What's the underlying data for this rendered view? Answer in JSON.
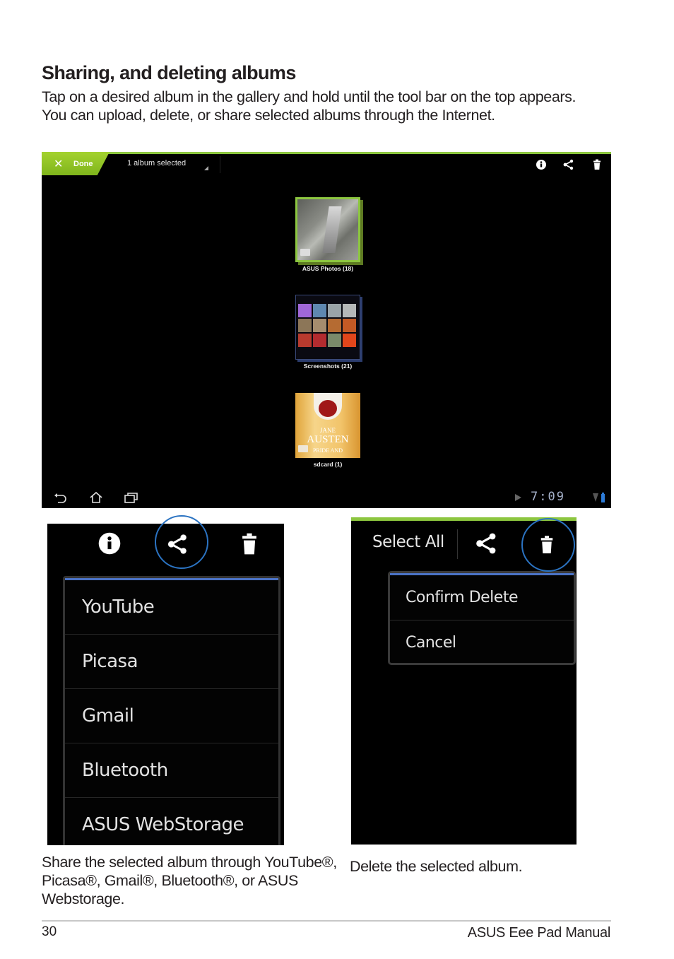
{
  "page": {
    "title": "Sharing, and deleting albums",
    "intro": "Tap on a desired album in the gallery and hold until the tool bar on the top appears. You can upload, delete, or share selected albums through the Internet.",
    "page_number": "30",
    "manual_name": "ASUS Eee Pad Manual"
  },
  "gallery_screen": {
    "done_label": "Done",
    "selection_label": "1 album selected",
    "toolbar_icons": [
      "info-icon",
      "share-icon",
      "trash-icon"
    ],
    "albums": [
      {
        "name": "ASUS Photos (18)",
        "selected": true
      },
      {
        "name": "Screenshots (21)",
        "selected": false
      },
      {
        "name": "sdcard (1)",
        "selected": false
      }
    ],
    "cover_text": {
      "line1": "JANE",
      "line2": "AUSTEN",
      "line3": "PRIDE AND"
    },
    "clock": "7:09",
    "nav_icons": [
      "back-icon",
      "home-icon",
      "recent-apps-icon"
    ]
  },
  "share_screen": {
    "toolbar_icons": [
      "info-icon",
      "share-icon",
      "trash-icon"
    ],
    "menu_items": [
      "YouTube",
      "Picasa",
      "Gmail",
      "Bluetooth",
      "ASUS WebStorage"
    ]
  },
  "delete_screen": {
    "select_all_label": "Select All",
    "menu_items": [
      "Confirm Delete",
      "Cancel"
    ]
  },
  "captions": {
    "share": "Share the selected album through YouTube®, Picasa®, Gmail®, Bluetooth®, or ASUS Webstorage.",
    "delete": "Delete the selected album."
  },
  "colors": {
    "accent_green": "#8cc63f",
    "highlight_blue": "#2b73c2",
    "menu_topline": "#4b73c6"
  }
}
